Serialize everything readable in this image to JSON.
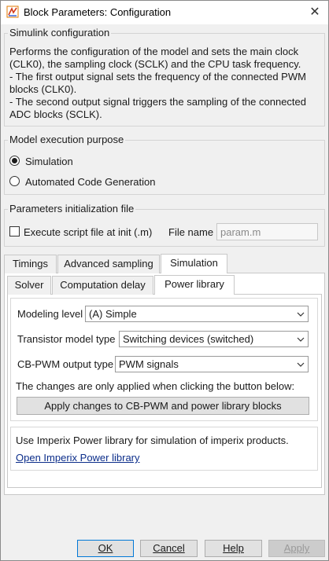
{
  "window": {
    "title": "Block Parameters: Configuration",
    "close_glyph": "✕",
    "icon": "simulink-block-icon"
  },
  "simulink_config": {
    "title": "Simulink configuration",
    "description_lines": [
      "Performs the configuration of the model and sets the main clock",
      "(CLK0), the sampling clock (SCLK) and the CPU task frequency.",
      "- The first output signal sets the frequency of the connected PWM",
      "blocks (CLK0).",
      "- The second output signal triggers the sampling of the connected",
      "ADC blocks (SCLK)."
    ]
  },
  "execution_purpose": {
    "title": "Model execution purpose",
    "options": [
      {
        "label": "Simulation",
        "checked": true
      },
      {
        "label": "Automated Code Generation",
        "checked": false
      }
    ]
  },
  "params_init": {
    "title": "Parameters initialization file",
    "checkbox_label": "Execute script file at init (.m)",
    "checkbox_checked": false,
    "file_name_label": "File name",
    "file_name_value": "param.m"
  },
  "main_tabs": [
    {
      "label": "Timings",
      "active": false
    },
    {
      "label": "Advanced sampling",
      "active": false
    },
    {
      "label": "Simulation",
      "active": true
    }
  ],
  "sub_tabs": [
    {
      "label": "Solver",
      "active": false
    },
    {
      "label": "Computation delay",
      "active": false
    },
    {
      "label": "Power library",
      "active": true
    }
  ],
  "power_library": {
    "modeling_level_label": "Modeling level",
    "modeling_level_value": "(A) Simple",
    "transistor_label": "Transistor model type",
    "transistor_value": "Switching devices (switched)",
    "cbpwm_label": "CB-PWM output type",
    "cbpwm_value": "PWM signals",
    "apply_note": "The changes are only applied when clicking the button below:",
    "apply_button": "Apply changes to CB-PWM and power library blocks",
    "info_text": "Use Imperix Power library for simulation of imperix products.",
    "open_link": "Open Imperix Power library"
  },
  "footer": {
    "ok": "OK",
    "cancel": "Cancel",
    "help": "Help",
    "apply": "Apply"
  }
}
